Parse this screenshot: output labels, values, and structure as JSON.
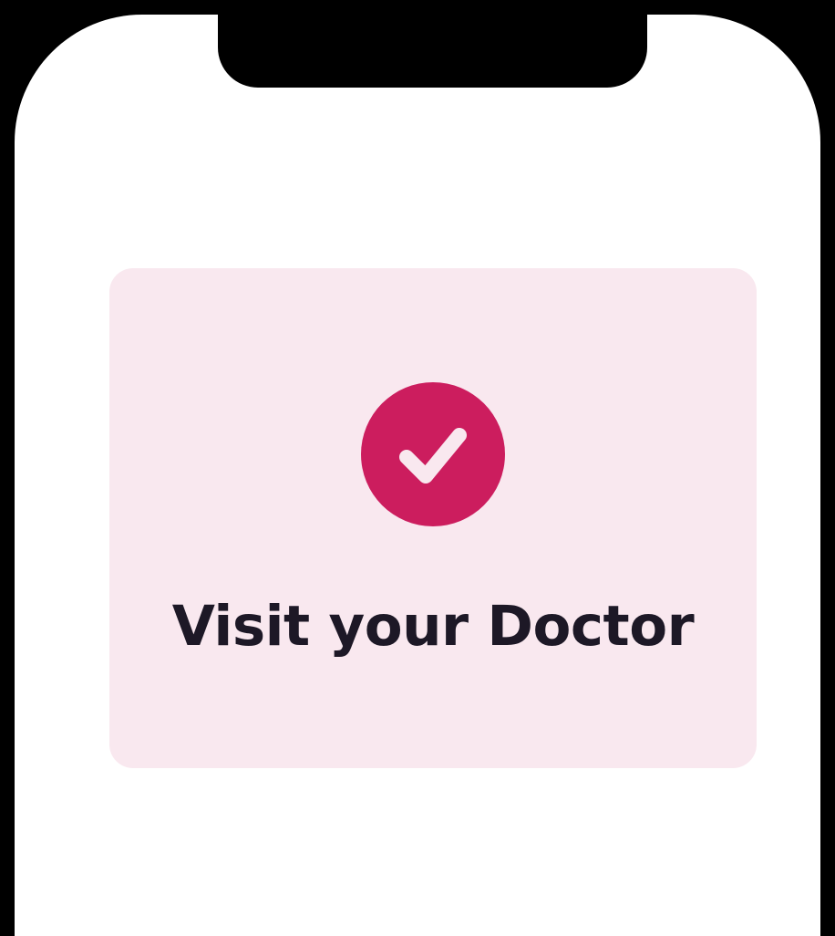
{
  "card": {
    "title": "Visit your Doctor",
    "icon": "check-circle-icon",
    "status": "completed"
  },
  "colors": {
    "frame": "#000000",
    "screen": "#ffffff",
    "card_background": "#f9e8ef",
    "accent": "#cc1d5e",
    "title_text": "#1d1826",
    "check_mark": "#f9e8ef"
  }
}
